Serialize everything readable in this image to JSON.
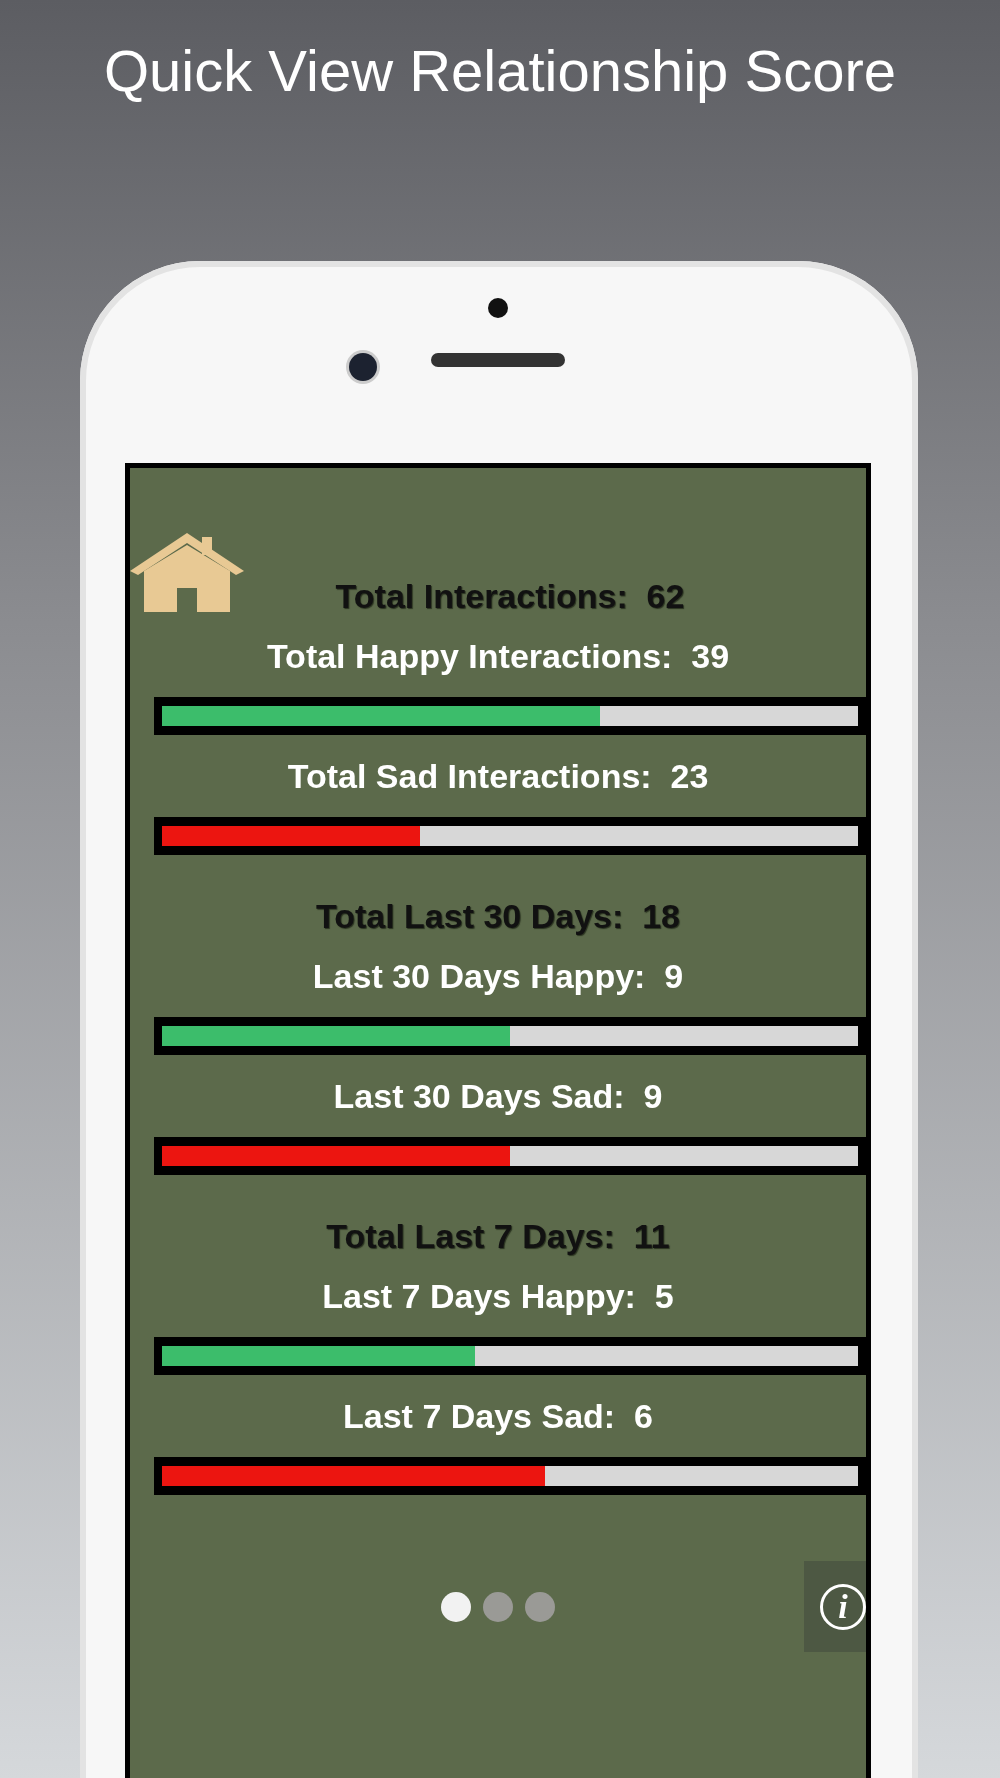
{
  "title": "Quick View Relationship Score",
  "sections": [
    {
      "total": {
        "label": "Total Interactions:",
        "value": "62"
      },
      "bars": [
        {
          "label": "Total Happy Interactions:",
          "value": "39",
          "kind": "happy",
          "level": 0.63
        },
        {
          "label": "Total Sad Interactions:",
          "value": "23",
          "kind": "sad",
          "level": 0.37
        }
      ]
    },
    {
      "total": {
        "label": "Total Last 30 Days:",
        "value": "18"
      },
      "bars": [
        {
          "label": "Last 30 Days Happy:",
          "value": "9",
          "kind": "happy",
          "level": 0.5
        },
        {
          "label": "Last 30 Days Sad:",
          "value": "9",
          "kind": "sad",
          "level": 0.5
        }
      ]
    },
    {
      "total": {
        "label": "Total Last 7 Days:",
        "value": "11"
      },
      "bars": [
        {
          "label": "Last 7 Days Happy:",
          "value": "5",
          "kind": "happy",
          "level": 0.45
        },
        {
          "label": "Last 7 Days Sad:",
          "value": "6",
          "kind": "sad",
          "level": 0.55
        }
      ]
    }
  ],
  "page_dots": [
    {
      "selected": true
    },
    {
      "selected": false
    },
    {
      "selected": false
    }
  ],
  "info_button": {
    "label": "i"
  }
}
